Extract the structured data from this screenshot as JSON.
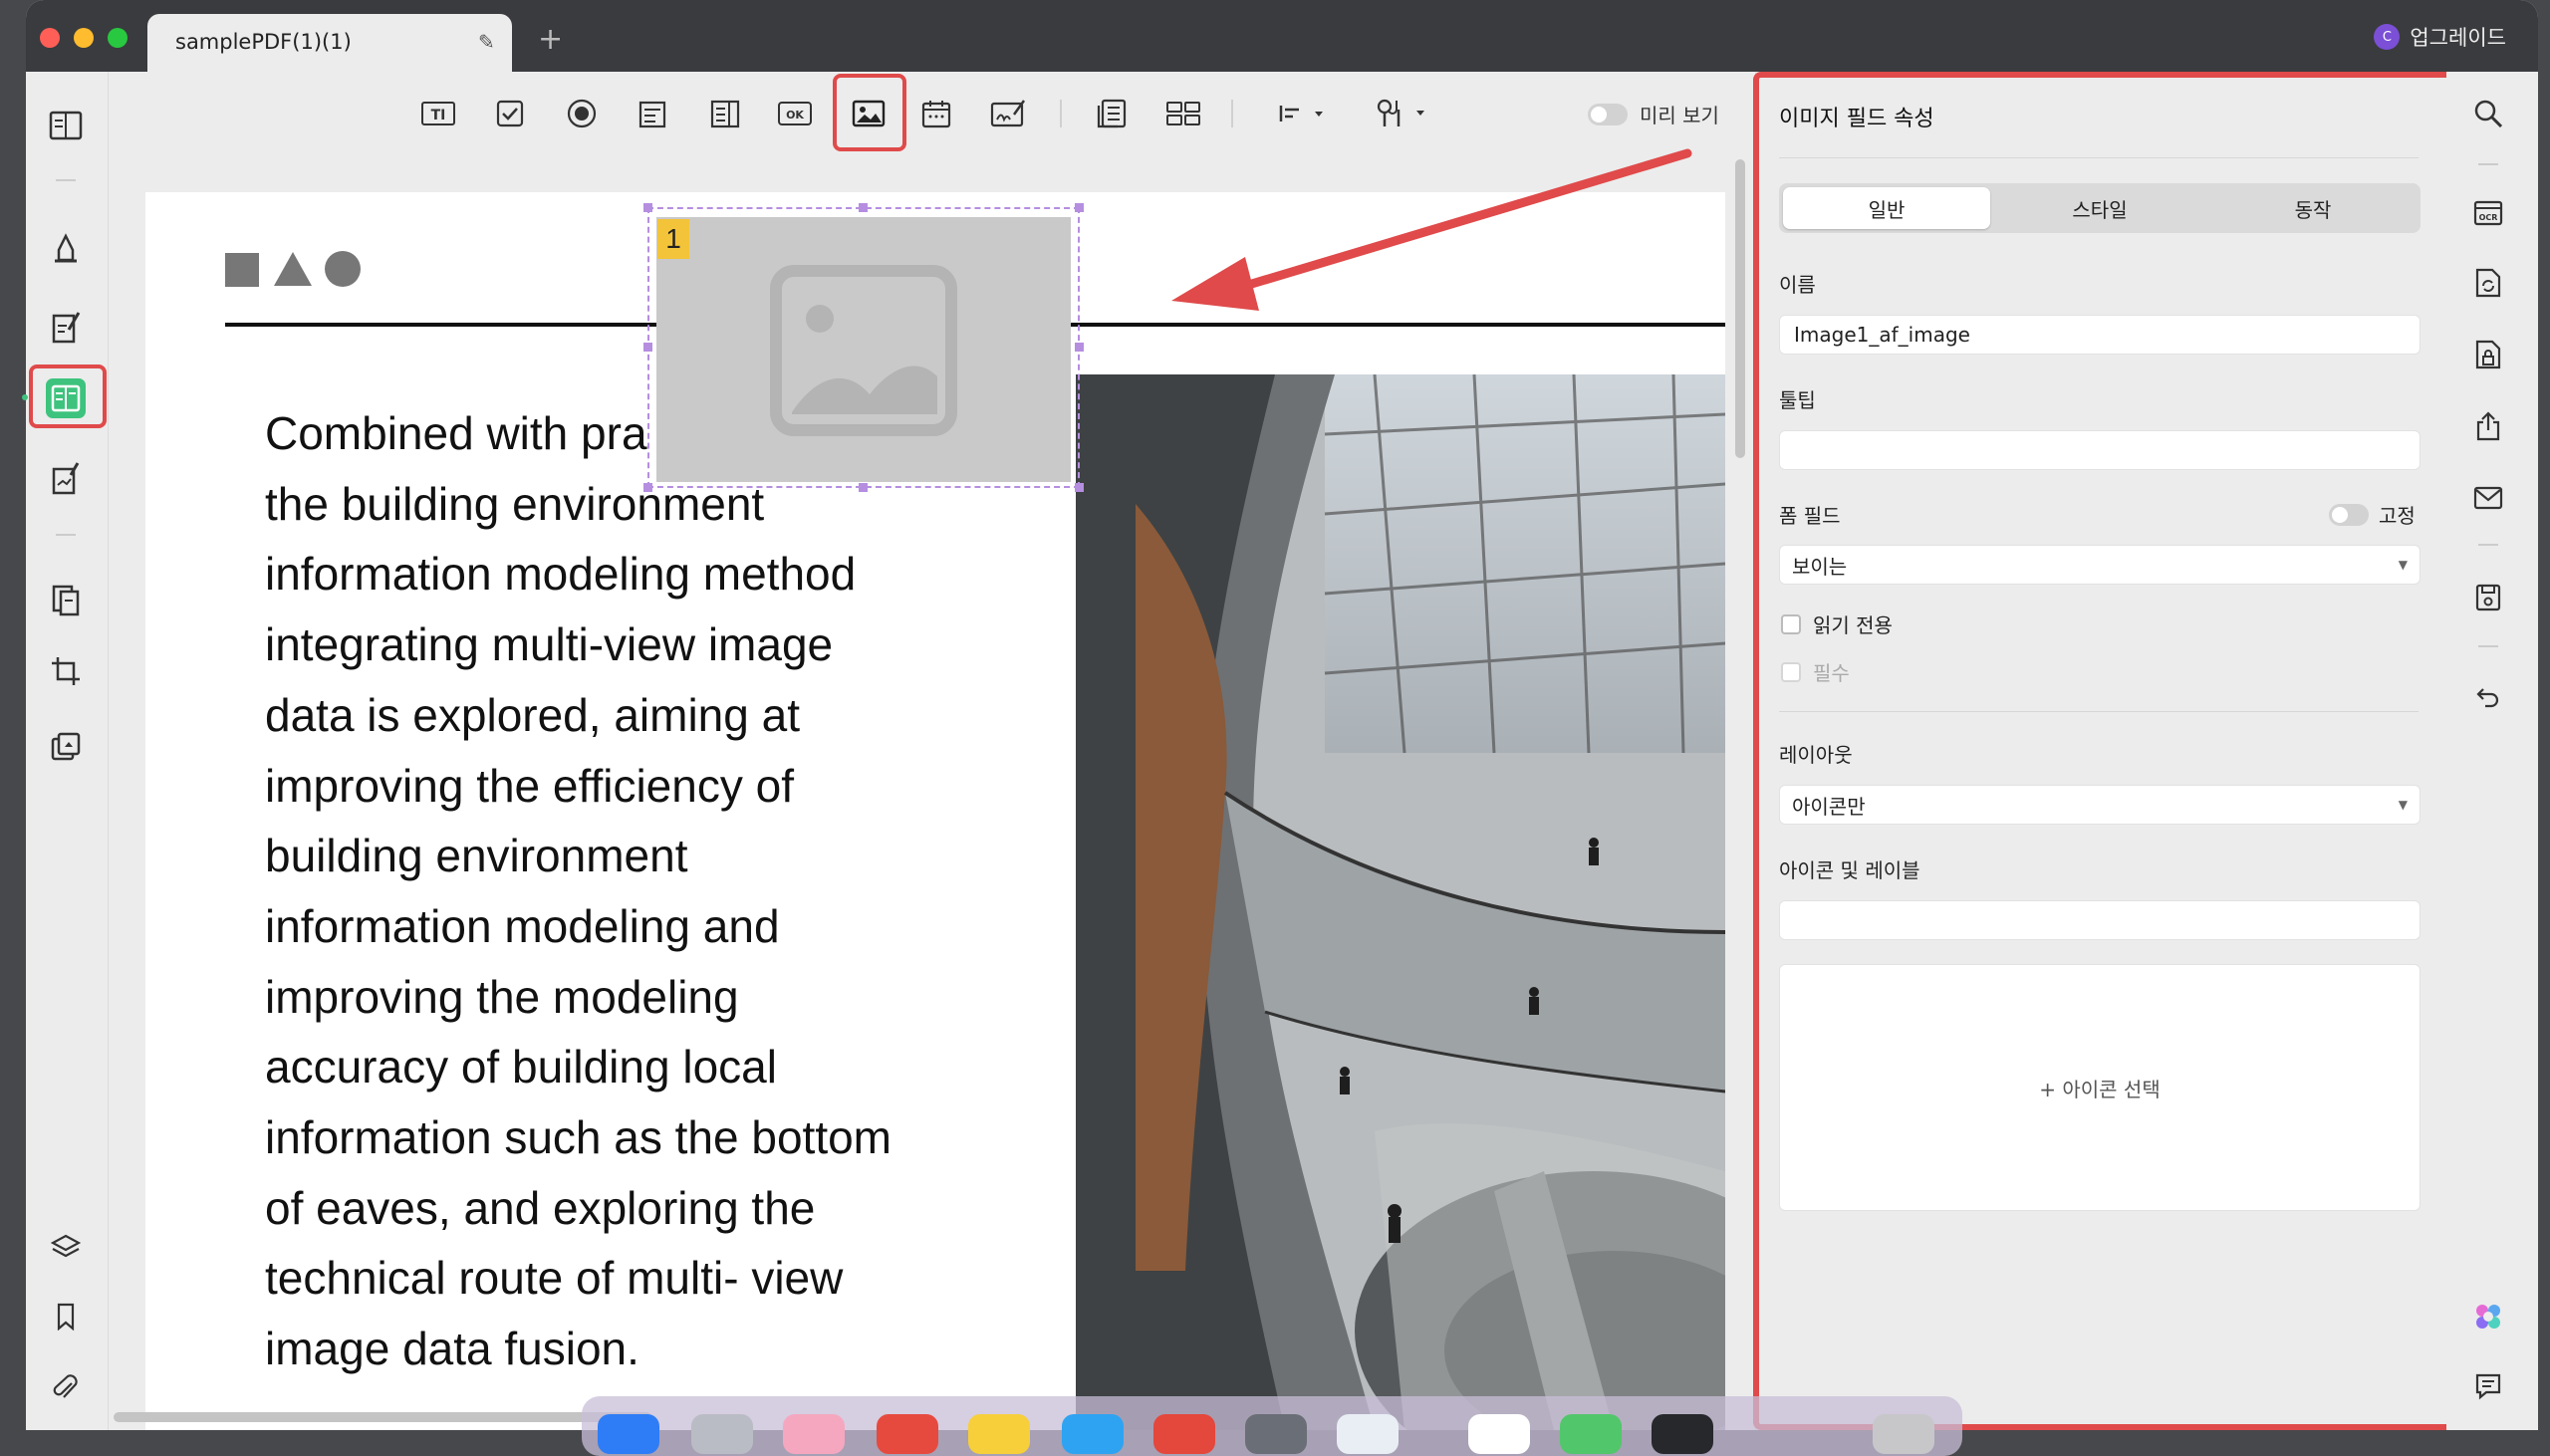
{
  "window": {
    "tab_title": "samplePDF(1)(1)",
    "upgrade_label": "업그레이드",
    "upgrade_avatar_initial": "C"
  },
  "toolbar": {
    "preview_label": "미리 보기",
    "active_tool": "image-field-tool",
    "tools": [
      "text-field-tool",
      "checkbox-tool",
      "radio-button-tool",
      "combo-box-tool",
      "list-box-tool",
      "button-tool",
      "image-field-tool",
      "date-field-tool",
      "signature-field-tool",
      "duplicate-field-tool",
      "grid-tool",
      "align-tool",
      "field-settings-tool"
    ]
  },
  "document": {
    "field_number": "1",
    "body_lines": [
      "Combined with pra",
      "the building environment",
      "information modeling method",
      "integrating multi-view image",
      "data is explored, aiming at",
      "improving the efficiency of",
      "building environment",
      "information modeling and",
      "improving the modeling",
      "accuracy of building local",
      "information such as the bottom",
      "of eaves, and exploring the",
      "technical route of multi- view",
      "image data fusion."
    ]
  },
  "panel": {
    "title": "이미지 필드 속성",
    "tabs": [
      {
        "label": "일반",
        "active": true
      },
      {
        "label": "스타일",
        "active": false
      },
      {
        "label": "동작",
        "active": false
      }
    ],
    "name_label": "이름",
    "name_value": "Image1_af_image",
    "tooltip_label": "툴팁",
    "tooltip_value": "",
    "form_field_label": "폼 필드",
    "fixed_label": "고정",
    "fixed_on": false,
    "visibility_value": "보이는",
    "readonly_label": "읽기 전용",
    "readonly_checked": false,
    "required_label": "필수",
    "required_checked": false,
    "layout_label": "레이아웃",
    "layout_value": "아이콘만",
    "icon_label_heading": "아이콘 및 레이블",
    "icon_label_value": "",
    "choose_icon_label": "+ 아이콘 선택"
  },
  "colors": {
    "highlight": "#e04a4a",
    "active_tool": "#3dc37d",
    "field_number_badge": "#f3c43a",
    "selection": "#b58ee0"
  }
}
